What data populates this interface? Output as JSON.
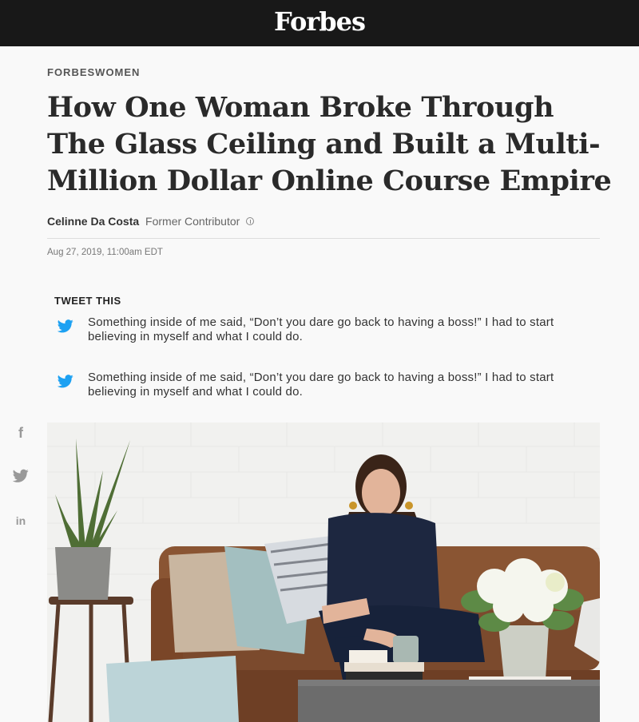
{
  "header": {
    "logo": "Forbes"
  },
  "article": {
    "section": "FORBESWOMEN",
    "headline": "How One Woman Broke Through The Glass Ceiling and Built a Multi-Million Dollar Online Course Empire",
    "author": "Celinne Da Costa",
    "author_role": "Former Contributor",
    "date": "Aug 27, 2019, 11:00am EDT"
  },
  "tweet_this": {
    "heading": "TWEET THIS",
    "items": [
      {
        "text": "Something inside of me said, “Don’t you dare go back to having a boss!” I had to start believing in myself and what I could do."
      },
      {
        "text": "Something inside of me said, “Don’t you dare go back to having a boss!” I had to start believing in myself and what I could do."
      }
    ]
  },
  "share": {
    "facebook_glyph": "f",
    "linkedin_glyph": "in",
    "icons": [
      "facebook-icon",
      "twitter-icon",
      "linkedin-icon"
    ]
  },
  "colors": {
    "topbar": "#181818",
    "twitter_blue": "#1da1f2",
    "page_bg": "#f9f9f9"
  }
}
